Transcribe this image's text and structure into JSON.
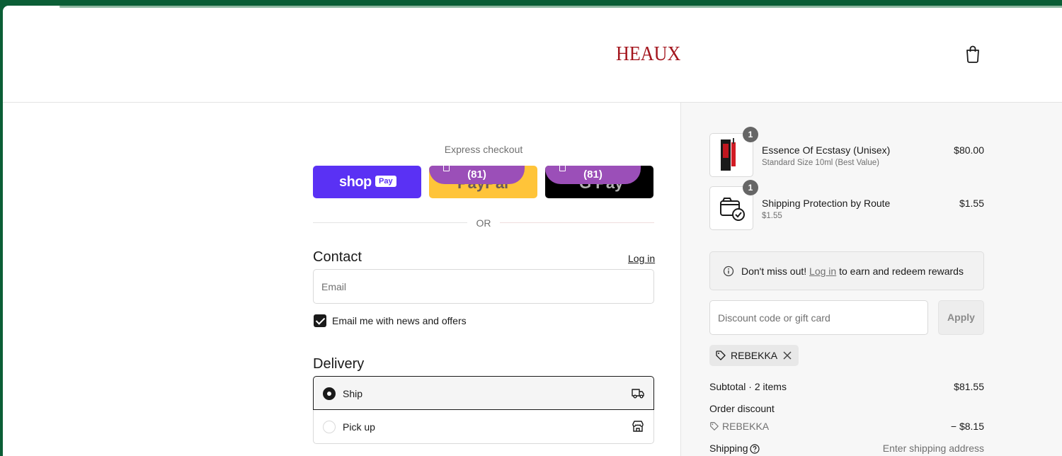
{
  "header": {
    "logo_text": "HEAUX",
    "cart_icon": "shopping-bag-icon"
  },
  "express": {
    "title": "Express checkout",
    "shop_pay_logo": "shop",
    "shop_pay_badge": "Pay",
    "paypal_text": "PayPal",
    "gpay_text": "G Pay",
    "overlay_count_1": "(81)",
    "overlay_count_2": "(81)",
    "divider_text": "OR"
  },
  "contact": {
    "heading": "Contact",
    "login_label": "Log in",
    "email_placeholder": "Email",
    "email_value": "",
    "news_checkbox_label": "Email me with news and offers",
    "news_checked": true
  },
  "delivery": {
    "heading": "Delivery",
    "options": [
      {
        "label": "Ship",
        "selected": true,
        "icon": "truck-icon"
      },
      {
        "label": "Pick up",
        "selected": false,
        "icon": "store-icon"
      }
    ]
  },
  "summary": {
    "items": [
      {
        "name": "Essence Of Ecstasy (Unisex)",
        "variant": "Standard Size 10ml (Best Value)",
        "price": "$80.00",
        "qty": "1"
      },
      {
        "name": "Shipping Protection by Route",
        "variant": "$1.55",
        "price": "$1.55",
        "qty": "1"
      }
    ],
    "rewards_prefix": "Don't miss out!",
    "rewards_link": "Log in",
    "rewards_suffix": "to earn and redeem rewards",
    "discount_placeholder": "Discount code or gift card",
    "apply_label": "Apply",
    "applied_code": "REBEKKA",
    "subtotal_label": "Subtotal · 2 items",
    "subtotal_value": "$81.55",
    "order_discount_label": "Order discount",
    "discount_code": "REBEKKA",
    "discount_value": "− $8.15",
    "shipping_label": "Shipping",
    "shipping_value": "Enter shipping address"
  },
  "colors": {
    "brand": "#a3151d",
    "shop_pay": "#5a31f4",
    "paypal": "#ffc439",
    "gpay": "#000000",
    "overlay": "#9b4fb8"
  }
}
